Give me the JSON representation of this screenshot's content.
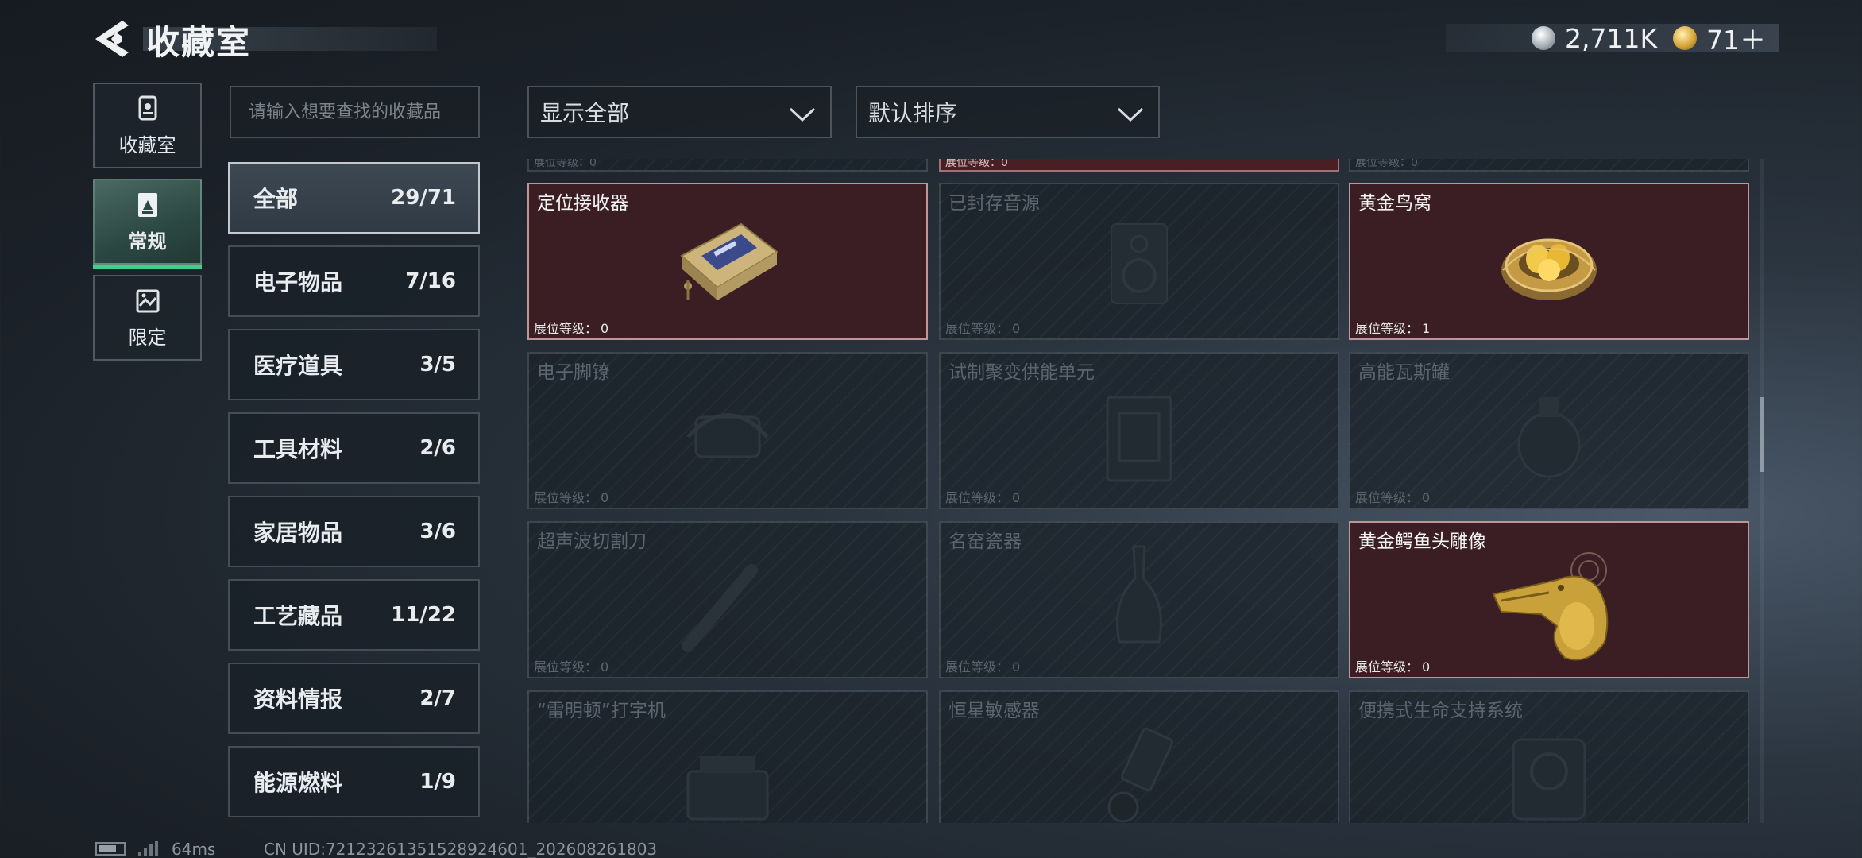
{
  "header": {
    "title": "收藏室",
    "currencies": [
      {
        "icon": "silver-coin-icon",
        "value": "2,711K"
      },
      {
        "icon": "gold-coin-icon",
        "value": "71＋"
      }
    ]
  },
  "rail": [
    {
      "label": "收藏室",
      "icon": "trophy-case-icon",
      "active": false
    },
    {
      "label": "常规",
      "icon": "document-icon",
      "active": true
    },
    {
      "label": "限定",
      "icon": "landscape-icon",
      "active": false
    }
  ],
  "search": {
    "placeholder": "请输入想要查找的收藏品"
  },
  "filters": {
    "show": "显示全部",
    "sort": "默认排序"
  },
  "categories": [
    {
      "name": "全部",
      "count": "29/71",
      "active": true
    },
    {
      "name": "电子物品",
      "count": "7/16"
    },
    {
      "name": "医疗道具",
      "count": "3/5"
    },
    {
      "name": "工具材料",
      "count": "2/6"
    },
    {
      "name": "家居物品",
      "count": "3/6"
    },
    {
      "name": "工艺藏品",
      "count": "11/22"
    },
    {
      "name": "资料情报",
      "count": "2/7"
    },
    {
      "name": "能源燃料",
      "count": "1/9"
    }
  ],
  "level_label": "展位等级：",
  "partial_row": [
    {
      "level": "0",
      "owned": false
    },
    {
      "level": "0",
      "owned": true
    },
    {
      "level": "0",
      "owned": false
    }
  ],
  "items": [
    {
      "name": "定位接收器",
      "level": "0",
      "owned": true,
      "art": "receiver"
    },
    {
      "name": "已封存音源",
      "level": "0",
      "owned": false,
      "art": "speaker"
    },
    {
      "name": "黄金鸟窝",
      "level": "1",
      "owned": true,
      "art": "nest"
    },
    {
      "name": "电子脚镣",
      "level": "0",
      "owned": false,
      "art": "anklet"
    },
    {
      "name": "试制聚变供能单元",
      "level": "0",
      "owned": false,
      "art": "fusion"
    },
    {
      "name": "高能瓦斯罐",
      "level": "0",
      "owned": false,
      "art": "gas"
    },
    {
      "name": "超声波切割刀",
      "level": "0",
      "owned": false,
      "art": "blade"
    },
    {
      "name": "名窑瓷器",
      "level": "0",
      "owned": false,
      "art": "vase"
    },
    {
      "name": "黄金鳄鱼头雕像",
      "level": "0",
      "owned": true,
      "art": "croc"
    },
    {
      "name": "“雷明顿”打字机",
      "level": "0",
      "owned": false,
      "art": "typewriter"
    },
    {
      "name": "恒星敏感器",
      "level": "0",
      "owned": false,
      "art": "sensor"
    },
    {
      "name": "便携式生命支持系统",
      "level": "0",
      "owned": false,
      "art": "lifesupport"
    }
  ],
  "footer": {
    "ping": "64ms",
    "uid": "CN UID:72123261351528924601_202608261803"
  },
  "colors": {
    "accent_green": "#3fd08b",
    "owned_card": "#3a1e23",
    "gold": "#d8a63c"
  }
}
